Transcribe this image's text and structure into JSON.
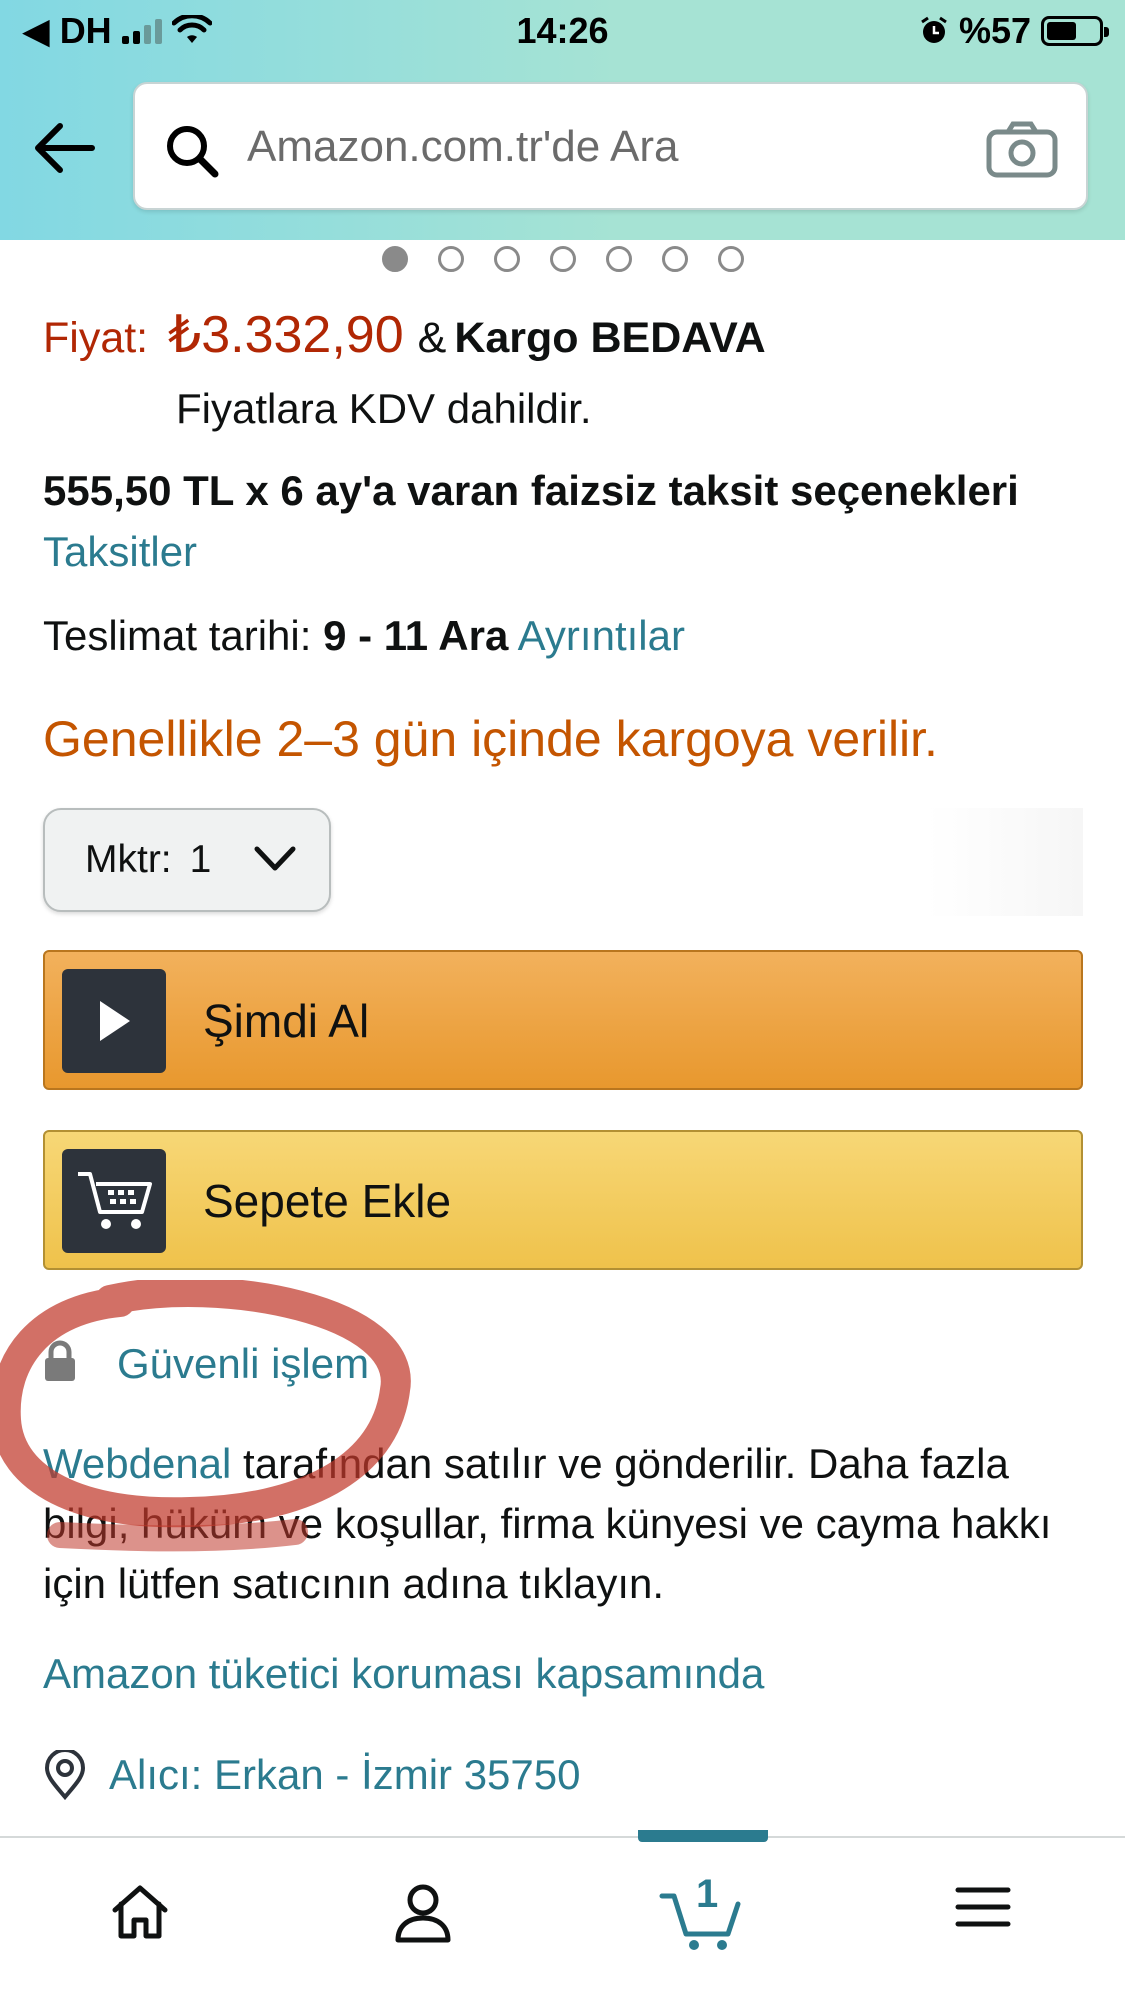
{
  "status_bar": {
    "carrier": "DH",
    "time": "14:26",
    "battery": "%57"
  },
  "search": {
    "placeholder": "Amazon.com.tr'de Ara"
  },
  "carousel": {
    "dot_count": 7,
    "active_index": 0
  },
  "product": {
    "price_label": "Fiyat:",
    "price_value": "₺3.332,90",
    "amp": "&",
    "shipping": "Kargo BEDAVA",
    "vat_note": "Fiyatlara KDV dahildir.",
    "installment_text": "555,50 TL x 6 ay'a varan faizsiz taksit seçenekleri",
    "installment_link": "Taksitler",
    "delivery_label": "Teslimat tarihi:",
    "delivery_dates": "9 - 11 Ara",
    "delivery_link": "Ayrıntılar",
    "availability": "Genellikle 2–3 gün içinde kargoya verilir."
  },
  "quantity": {
    "label": "Mktr:",
    "value": "1"
  },
  "buttons": {
    "buy_now": "Şimdi Al",
    "add_to_cart": "Sepete Ekle"
  },
  "secure": {
    "label": "Güvenli işlem"
  },
  "seller": {
    "name": "Webdenal",
    "text": " tarafından satılır ve gönderilir. Daha fazla bilgi, hüküm ve koşullar, firma künyesi ve cayma hakkı için lütfen satıcının adına tıklayın."
  },
  "protection_link": "Amazon tüketici koruması kapsamında",
  "address_link": "Alıcı: Erkan - İzmir 35750",
  "bottom_nav": {
    "cart_count": "1",
    "items": [
      "home-icon",
      "account-icon",
      "cart-icon",
      "menu-icon"
    ]
  },
  "colors": {
    "price": "#b12704",
    "link": "#2b7b8f",
    "availability": "#c45500",
    "buy_button": "#e8982e",
    "cart_button": "#efc24b",
    "annotation": "#c0392b"
  }
}
